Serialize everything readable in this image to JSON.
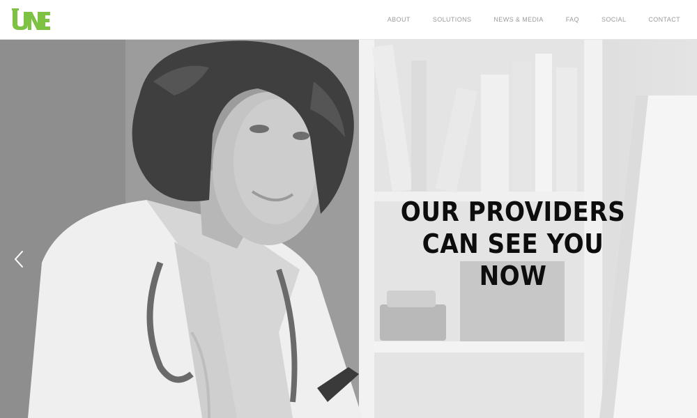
{
  "site": {
    "logo_text": "UNE",
    "brand_color": "#7dc242"
  },
  "nav": {
    "items": [
      {
        "label": "ABOUT",
        "name": "nav-about"
      },
      {
        "label": "SOLUTIONS",
        "name": "nav-solutions"
      },
      {
        "label": "NEWS & MEDIA",
        "name": "nav-news-media"
      },
      {
        "label": "FAQ",
        "name": "nav-faq"
      },
      {
        "label": "SOCIAL",
        "name": "nav-social"
      },
      {
        "label": "CONTACT",
        "name": "nav-contact"
      }
    ]
  },
  "hero": {
    "headline_line1": "OUR PROVIDERS",
    "headline_line2": "CAN SEE YOU NOW",
    "prev_icon": "chevron-left-icon",
    "image_subject": "doctor-photo"
  }
}
